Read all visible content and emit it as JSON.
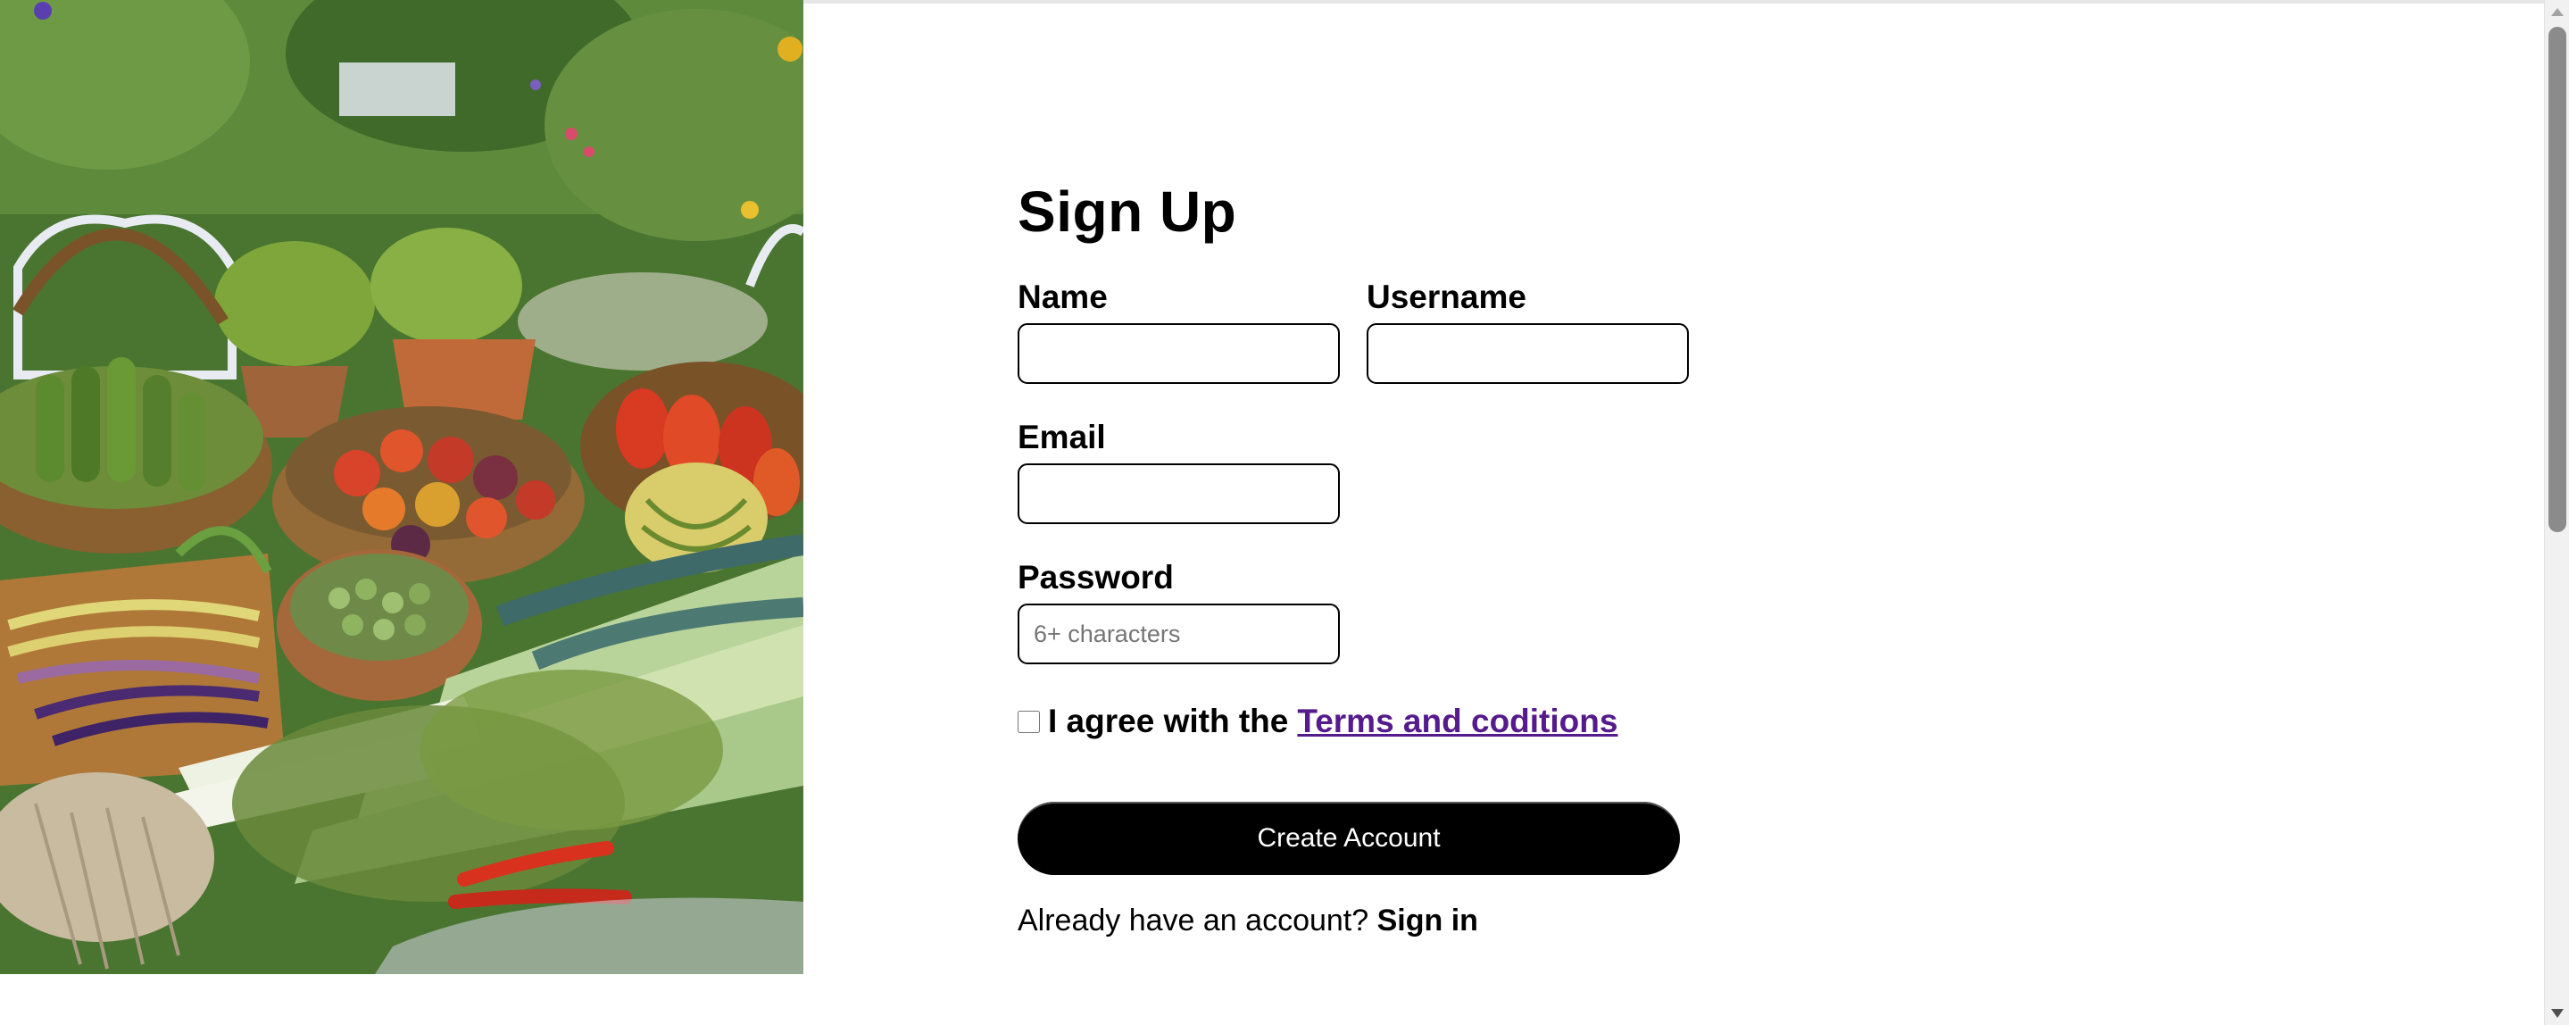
{
  "hero": {
    "image_alt": "Harvest of vegetables in baskets on a garden bench"
  },
  "signup": {
    "title": "Sign Up",
    "name": {
      "label": "Name",
      "value": "",
      "placeholder": ""
    },
    "username": {
      "label": "Username",
      "value": "",
      "placeholder": ""
    },
    "email": {
      "label": "Email",
      "value": "",
      "placeholder": ""
    },
    "password": {
      "label": "Password",
      "value": "",
      "placeholder": "6+ characters"
    },
    "agree": {
      "text": "I agree with the",
      "link_text": "Terms and coditions",
      "checked": false
    },
    "submit_label": "Create Account",
    "signin_prompt": "Already have an account?",
    "signin_link": "Sign in"
  },
  "colors": {
    "link_visited": "#551a8b",
    "button_bg": "#000000",
    "button_text": "#ffffff"
  }
}
